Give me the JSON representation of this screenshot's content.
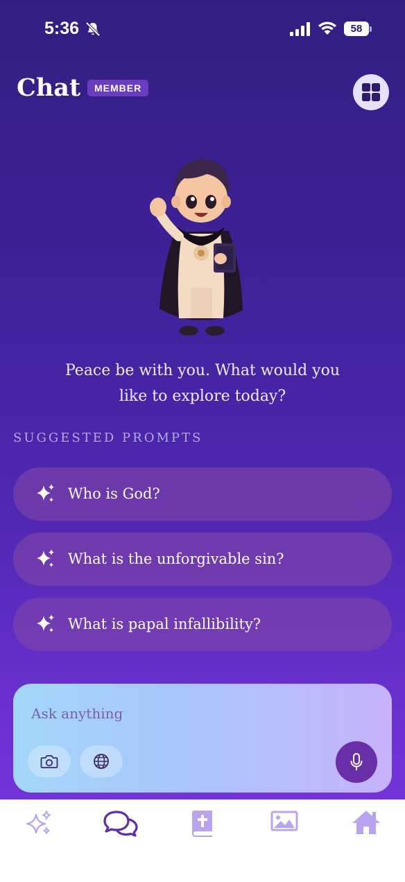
{
  "status_bar": {
    "time": "5:36",
    "battery": "58",
    "icons": [
      "bell-slash-icon",
      "signal-icon",
      "wifi-icon",
      "battery-icon"
    ]
  },
  "header": {
    "title": "Chat",
    "badge": "MEMBER",
    "menu_icon": "grid-icon"
  },
  "greeting": {
    "line1": "Peace be with you. What would you",
    "line2": "like to explore today?"
  },
  "suggested": {
    "label": "SUGGESTED PROMPTS",
    "prompts": [
      {
        "text": "Who is God?",
        "icon": "sparkle-icon"
      },
      {
        "text": "What is the unforgivable sin?",
        "icon": "sparkle-icon"
      },
      {
        "text": "What is papal infallibility?",
        "icon": "sparkle-icon"
      }
    ]
  },
  "composer": {
    "placeholder": "Ask anything",
    "value": "",
    "buttons": [
      "camera-icon",
      "globe-icon",
      "microphone-icon"
    ]
  },
  "tab_bar": {
    "tabs": [
      {
        "icon": "sparkles-icon",
        "active": false
      },
      {
        "icon": "chat-bubbles-icon",
        "active": true
      },
      {
        "icon": "bible-icon",
        "active": false
      },
      {
        "icon": "image-icon",
        "active": false
      },
      {
        "icon": "home-icon",
        "active": false
      }
    ]
  },
  "colors": {
    "background_top": "#311f80",
    "background_bottom": "#7a36e3",
    "accent": "#6a2fa8",
    "badge": "#6a3dbf",
    "prompt_pill": "#7f46a8",
    "tab_active": "#5c2fa5",
    "tab_inactive": "#b8a4ef"
  }
}
